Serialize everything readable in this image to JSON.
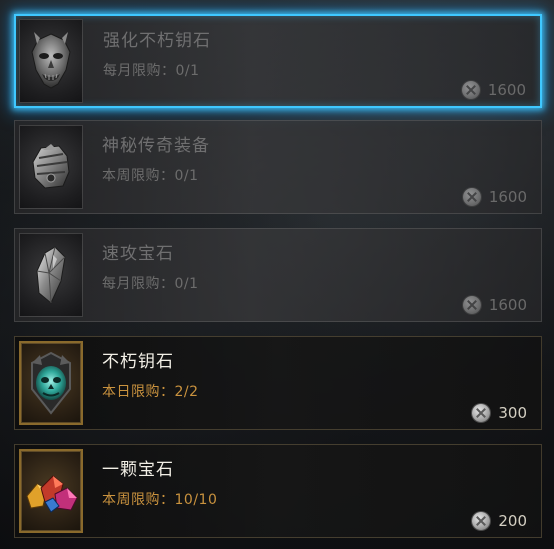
{
  "items": [
    {
      "name": "强化不朽钥石",
      "limit": "每月限购：0/1",
      "price": "1600",
      "icon": "demon-mask-icon",
      "state": "locked",
      "selected": true
    },
    {
      "name": "神秘传奇装备",
      "limit": "本周限购：0/1",
      "price": "1600",
      "icon": "gauntlet-icon",
      "state": "locked",
      "selected": false
    },
    {
      "name": "速攻宝石",
      "limit": "每月限购：0/1",
      "price": "1600",
      "icon": "crystal-shard-icon",
      "state": "locked",
      "selected": false
    },
    {
      "name": "不朽钥石",
      "limit": "本日限购：2/2",
      "price": "300",
      "icon": "teal-skull-crest-icon",
      "state": "available",
      "selected": false
    },
    {
      "name": "一颗宝石",
      "limit": "本周限购：10/10",
      "price": "200",
      "icon": "gem-cluster-icon",
      "state": "available",
      "selected": false
    }
  ],
  "currency_icon": "platinum-coin-icon",
  "colors": {
    "selection_glow": "#3fc8ff",
    "limit_available": "#c9923e",
    "name_available": "#f2efe6",
    "locked_text": "#6f6f70"
  }
}
